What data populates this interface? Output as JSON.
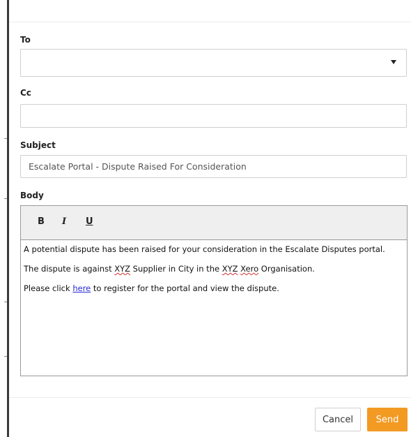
{
  "form": {
    "to": {
      "label": "To",
      "value": ""
    },
    "cc": {
      "label": "Cc",
      "value": ""
    },
    "subject": {
      "label": "Subject",
      "value": "Escalate Portal - Dispute Raised For Consideration"
    },
    "body": {
      "label": "Body",
      "toolbar": {
        "bold": "B",
        "italic": "I",
        "underline": "U"
      },
      "paragraphs": {
        "p1": "A potential dispute has been raised for your consideration in the Escalate Disputes portal.",
        "p2": {
          "a": "The dispute is against ",
          "b": "XYZ",
          "c": " Supplier in City in the ",
          "d": "XYZ",
          "e": " ",
          "f": "Xero",
          "g": " Organisation."
        },
        "p3": {
          "a": "Please click ",
          "link": "here",
          "b": " to register for the portal and view the dispute."
        }
      }
    }
  },
  "actions": {
    "cancel": "Cancel",
    "send": "Send"
  },
  "colors": {
    "accent": "#f39a23",
    "link": "#2a2ad8"
  }
}
